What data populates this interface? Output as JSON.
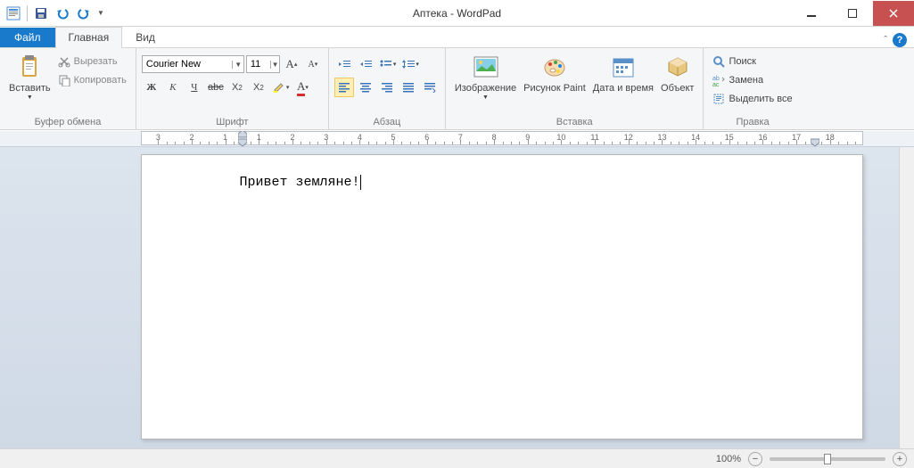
{
  "window": {
    "title": "Аптека - WordPad"
  },
  "qat": {
    "save": "save",
    "undo": "undo",
    "redo": "redo"
  },
  "tabs": {
    "file": "Файл",
    "home": "Главная",
    "view": "Вид"
  },
  "clipboard": {
    "group_label": "Буфер обмена",
    "paste": "Вставить",
    "cut": "Вырезать",
    "copy": "Копировать"
  },
  "font": {
    "group_label": "Шрифт",
    "family": "Courier New",
    "size": "11",
    "bold": "Ж",
    "italic": "К",
    "underline": "Ч",
    "strike": "abc",
    "sub": "X₂",
    "sup": "X²",
    "color_label": "A"
  },
  "paragraph": {
    "group_label": "Абзац"
  },
  "insert": {
    "group_label": "Вставка",
    "image": "Изображение",
    "paint": "Рисунок Paint",
    "datetime": "Дата и время",
    "object": "Объект"
  },
  "editing": {
    "group_label": "Правка",
    "find": "Поиск",
    "replace": "Замена",
    "select_all": "Выделить все"
  },
  "ruler": {
    "nums": [
      "3",
      "2",
      "1",
      "1",
      "2",
      "3",
      "4",
      "5",
      "6",
      "7",
      "8",
      "9",
      "10",
      "11",
      "12",
      "13",
      "14",
      "15",
      "16",
      "17",
      "18"
    ]
  },
  "document": {
    "text": "Привет земляне!"
  },
  "status": {
    "zoom": "100%"
  }
}
